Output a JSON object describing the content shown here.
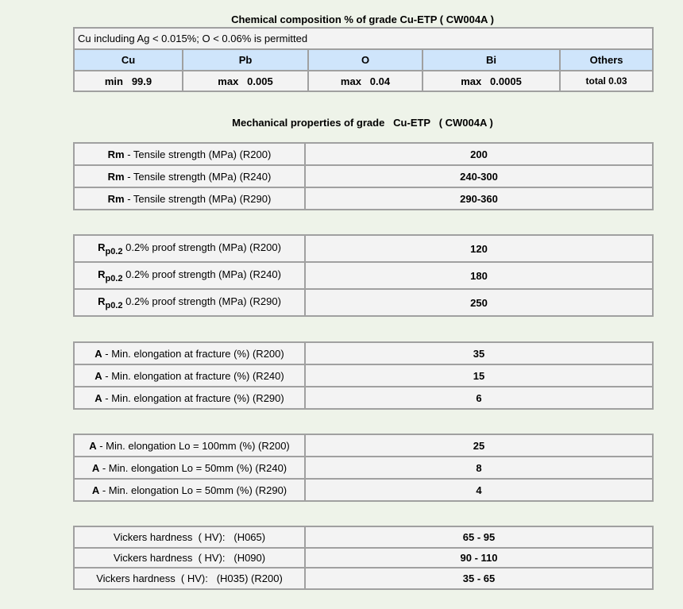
{
  "chem_title": "Chemical composition %   of grade   Cu-ETP   ( CW004A )",
  "chem_note": "Cu including Ag < 0.015%; O < 0.06% is permitted",
  "chem_headers": [
    "Cu",
    "Pb",
    "O",
    "Bi",
    "Others"
  ],
  "chem_values": [
    "min   99.9",
    "max   0.005",
    "max   0.04",
    "max   0.0005",
    "total 0.03"
  ],
  "mech_title": "Mechanical properties of grade   Cu-ETP   ( CW004A )",
  "tensile": [
    {
      "sym": "Rm",
      "text": " - Tensile strength (MPa) (R200)",
      "value": "200"
    },
    {
      "sym": "Rm",
      "text": " - Tensile strength (MPa) (R240)",
      "value": "240-300"
    },
    {
      "sym": "Rm",
      "text": " - Tensile strength (MPa) (R290)",
      "value": "290-360"
    }
  ],
  "proof": [
    {
      "sym": "R",
      "sub": "p0.2",
      "text": " 0.2% proof strength (MPa) (R200)",
      "value": "120"
    },
    {
      "sym": "R",
      "sub": "p0.2",
      "text": " 0.2% proof strength (MPa) (R240)",
      "value": "180"
    },
    {
      "sym": "R",
      "sub": "p0.2",
      "text": " 0.2% proof strength (MPa) (R290)",
      "value": "250"
    }
  ],
  "elong_fracture": [
    {
      "sym": "A",
      "text": " - Min. elongation at fracture (%) (R200)",
      "value": "35"
    },
    {
      "sym": "A",
      "text": " - Min. elongation at fracture (%) (R240)",
      "value": "15"
    },
    {
      "sym": "A",
      "text": " - Min. elongation at fracture (%) (R290)",
      "value": "6"
    }
  ],
  "elong_lo": [
    {
      "sym": "A",
      "text": " - Min. elongation Lo = 100mm (%) (R200)",
      "value": "25"
    },
    {
      "sym": "A",
      "text": " - Min. elongation Lo = 50mm (%) (R240)",
      "value": "8"
    },
    {
      "sym": "A",
      "text": " - Min. elongation Lo = 50mm (%) (R290)",
      "value": "4"
    }
  ],
  "hardness": [
    {
      "text": "Vickers hardness  ( HV):   (H065)",
      "value": "65 - 95"
    },
    {
      "text": "Vickers hardness  ( HV):   (H090)",
      "value": "90 - 110"
    },
    {
      "text": "Vickers hardness  ( HV):   (H035) (R200)",
      "value": "35 - 65"
    }
  ]
}
